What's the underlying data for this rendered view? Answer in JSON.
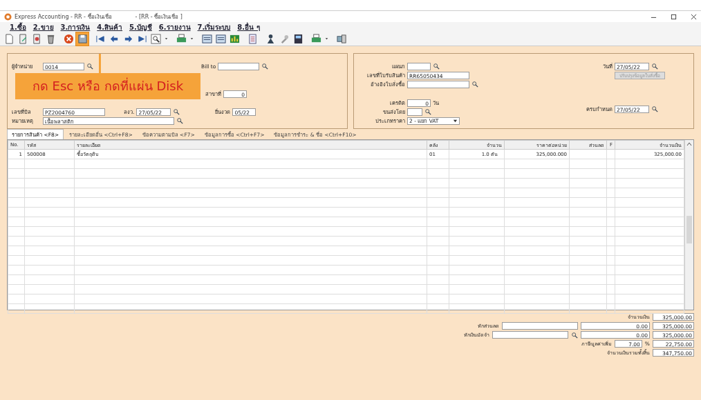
{
  "window": {
    "title": "Express Accounting - RR - ซื้อเงินเชื่อ",
    "doc_title": "- [RR - ซื้อเงินเชื่อ      ]"
  },
  "menu": [
    "1.ซื้อ",
    "2.ขาย",
    "3.การเงิน",
    "4.สินค้า",
    "5.บัญชี",
    "6.รายงาน",
    "7.เริ่มระบบ",
    "8.อื่น ๆ"
  ],
  "toolbar": [
    {
      "kind": "new",
      "selected": false
    },
    {
      "kind": "edit",
      "selected": false
    },
    {
      "kind": "copy",
      "selected": false
    },
    {
      "kind": "trash",
      "selected": false
    },
    {
      "kind": "sep"
    },
    {
      "kind": "cancel",
      "selected": false
    },
    {
      "kind": "save",
      "selected": true
    },
    {
      "kind": "sep"
    },
    {
      "kind": "first",
      "selected": false
    },
    {
      "kind": "prev",
      "selected": false
    },
    {
      "kind": "next",
      "selected": false
    },
    {
      "kind": "last",
      "selected": false
    },
    {
      "kind": "find",
      "selected": false
    },
    {
      "kind": "drop",
      "selected": false
    },
    {
      "kind": "sep"
    },
    {
      "kind": "print",
      "selected": false
    },
    {
      "kind": "drop",
      "selected": false
    },
    {
      "kind": "sep"
    },
    {
      "kind": "form",
      "selected": false
    },
    {
      "kind": "form",
      "selected": false
    },
    {
      "kind": "chart",
      "selected": false
    },
    {
      "kind": "sep"
    },
    {
      "kind": "doc",
      "selected": false
    },
    {
      "kind": "sep"
    },
    {
      "kind": "person",
      "selected": false
    },
    {
      "kind": "tool",
      "selected": false
    },
    {
      "kind": "disk",
      "selected": false
    },
    {
      "kind": "sep"
    },
    {
      "kind": "print",
      "selected": false
    },
    {
      "kind": "drop",
      "selected": false
    },
    {
      "kind": "sep"
    },
    {
      "kind": "net",
      "selected": false
    }
  ],
  "callout": "กด Esc หรือ  กดที่แผ่น Disk",
  "left_form": {
    "supplier": {
      "label": "ผู้จำหน่าย",
      "value": "0014"
    },
    "bill_to": {
      "label": "Bill to"
    },
    "branch": {
      "label": "สาขาที่",
      "value": "0"
    },
    "bill_no": {
      "label": "เลขที่บิล",
      "value": "PZ2004760"
    },
    "bill_date": {
      "label": "ลงว.",
      "value": "27/05/22"
    },
    "period": {
      "label": "ยื่นงวด",
      "value": "05/22"
    },
    "note": {
      "label": "หมายเหตุ",
      "value": "เนื้อพลาสติก"
    }
  },
  "right_form": {
    "department": {
      "label": "แผนก"
    },
    "receipt_no": {
      "label": "เลขที่ใบรับสินค้า",
      "value": "RR65050434"
    },
    "po_ref": {
      "label": "อ้างอิงใบสั่งซื้อ"
    },
    "date": {
      "label": "วันที่",
      "value": "27/05/22"
    },
    "po_button": {
      "label": "ปรับปรุงข้อมูลใบสั่งซื้อ",
      "disabled": true
    },
    "credit": {
      "label": "เครดิต",
      "value": "0",
      "unit": "วัน"
    },
    "due": {
      "label": "ครบกำหนด",
      "value": "27/05/22"
    },
    "ship_by": {
      "label": "ขนส่งโดย"
    },
    "price_type": {
      "label": "ประเภทราคา",
      "value": "2 - แยก VAT"
    }
  },
  "tabs": [
    {
      "label": "รายการสินค้า <F8>",
      "selected": true
    },
    {
      "label": "รายละเอียดอื่น <Ctrl+F8>",
      "selected": false
    },
    {
      "label": "ข้อความตามบิล <F7>",
      "selected": false
    },
    {
      "label": "ข้อมูลการซื้อ <Ctrl+F7>",
      "selected": false
    },
    {
      "label": "ข้อมูลการชำระ & ชื่อ <Ctrl+F10>",
      "selected": false
    }
  ],
  "table": {
    "columns": [
      "No.",
      "รหัส",
      "รายละเอียด",
      "คลัง",
      "จำนวน",
      "ราคาต่อหน่วย",
      "ส่วนลด",
      "F",
      "จำนวนเงิน"
    ],
    "rows": [
      {
        "no": "1",
        "code": "500008",
        "description": "ซื้อวัตถุดิบ",
        "warehouse": "01",
        "qty": "1.0",
        "unit": "ตัน",
        "unit_price": "325,000.000",
        "amount": "325,000.00"
      }
    ]
  },
  "totals": {
    "amount": {
      "label": "จำนวนเงิน",
      "value": "325,000.00"
    },
    "discount": {
      "label": "หักส่วนลด",
      "value": "0.00",
      "total": "325,000.00"
    },
    "deposit": {
      "label": "หักเงินมัดจำ",
      "value": "0.00",
      "total": "325,000.00"
    },
    "vat": {
      "label": "ภาษีมูลค่าเพิ่ม",
      "rate": "7.00",
      "unit": "%",
      "value": "22,750.00"
    },
    "grand_total": {
      "label": "จำนวนเงินรวมทั้งสิ้น",
      "value": "347,750.00"
    }
  }
}
